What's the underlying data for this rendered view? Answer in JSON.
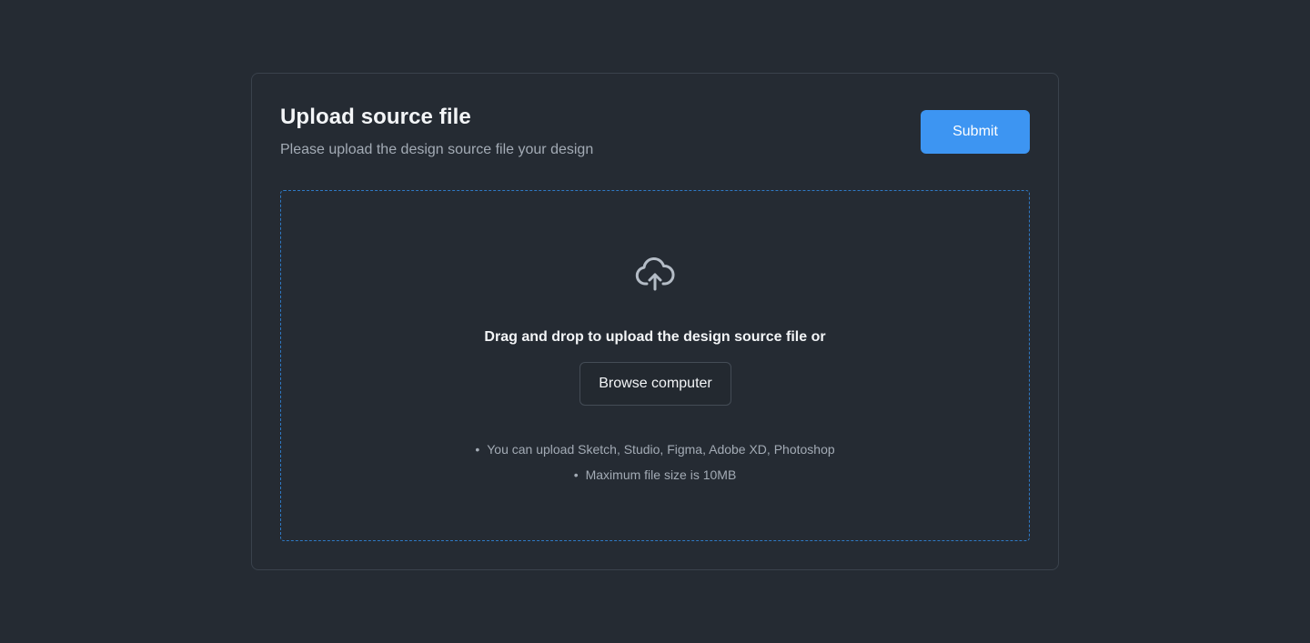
{
  "header": {
    "title": "Upload source file",
    "subtitle": "Please upload the design source file your design",
    "submit_label": "Submit"
  },
  "dropzone": {
    "icon": "cloud-upload-icon",
    "instruction": "Drag and drop to upload the design source file or",
    "browse_label": "Browse computer",
    "hints": [
      "You can upload Sketch, Studio, Figma, Adobe XD, Photoshop",
      "Maximum file size is 10MB"
    ]
  },
  "colors": {
    "background": "#252b33",
    "accent": "#3d95f2",
    "dropzone_border": "#2f79c4",
    "text_primary": "#f3f5f7",
    "text_secondary": "#a3abb5"
  }
}
